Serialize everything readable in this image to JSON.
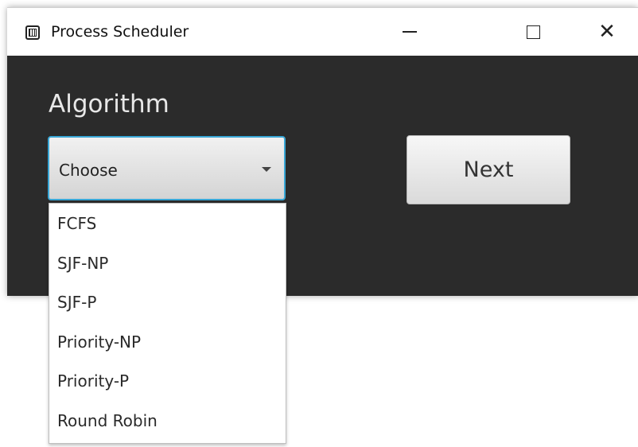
{
  "window": {
    "title": "Process Scheduler",
    "controls": {
      "minimize": "—",
      "maximize": "☐",
      "close": "✕"
    }
  },
  "main": {
    "section_label": "Algorithm",
    "combo": {
      "selected": "Choose",
      "open": true,
      "options": [
        "FCFS",
        "SJF-NP",
        "SJF-P",
        "Priority-NP",
        "Priority-P",
        "Round Robin"
      ]
    },
    "next_label": "Next"
  },
  "colors": {
    "window_bg": "#2b2b2b",
    "focus_border": "#39a7d6",
    "label_text": "#e8e8e8"
  }
}
